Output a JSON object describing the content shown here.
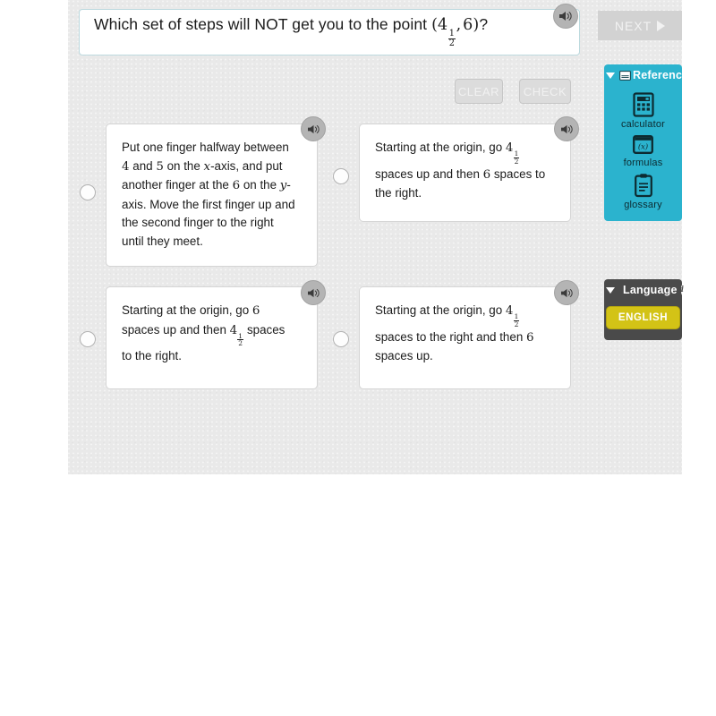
{
  "question": {
    "prefix": "Which set of steps will NOT get you to the point ",
    "point_whole": "4",
    "point_num": "1",
    "point_den": "2",
    "point_y": "6",
    "suffix": "?",
    "speaker_icon": "speaker-icon"
  },
  "toolbar": {
    "clear_label": "CLEAR",
    "check_label": "CHECK",
    "next_label": "NEXT"
  },
  "options": [
    {
      "id": "opt-1",
      "selected": false,
      "parts": [
        {
          "t": "text",
          "v": "Put one finger halfway between "
        },
        {
          "t": "math",
          "v": "4"
        },
        {
          "t": "text",
          "v": " and "
        },
        {
          "t": "math",
          "v": "5"
        },
        {
          "t": "text",
          "v": " on the "
        },
        {
          "t": "mathit",
          "v": "x"
        },
        {
          "t": "text",
          "v": "-axis, and put another finger at the "
        },
        {
          "t": "math",
          "v": "6"
        },
        {
          "t": "text",
          "v": " on the "
        },
        {
          "t": "mathit",
          "v": "y"
        },
        {
          "t": "text",
          "v": "-axis. Move the first finger up and the second finger to the right until they meet."
        }
      ],
      "plain": "Put one finger halfway between 4 and 5 on the x-axis, and put another finger at the 6 on the y-axis. Move the first finger up and the second finger to the right until they meet."
    },
    {
      "id": "opt-2",
      "selected": false,
      "parts": [
        {
          "t": "text",
          "v": "Starting at the origin, go "
        },
        {
          "t": "mixed",
          "whole": "4",
          "num": "1",
          "den": "2"
        },
        {
          "t": "text",
          "v": " spaces up and then "
        },
        {
          "t": "math",
          "v": "6"
        },
        {
          "t": "text",
          "v": " spaces to the right."
        }
      ],
      "plain": "Starting at the origin, go 4 1/2 spaces up and then 6 spaces to the right."
    },
    {
      "id": "opt-3",
      "selected": false,
      "parts": [
        {
          "t": "text",
          "v": "Starting at the origin, go "
        },
        {
          "t": "math",
          "v": "6"
        },
        {
          "t": "text",
          "v": " spaces up and then "
        },
        {
          "t": "mixed",
          "whole": "4",
          "num": "1",
          "den": "2"
        },
        {
          "t": "text",
          "v": " spaces to the right."
        }
      ],
      "plain": "Starting at the origin, go 6 spaces up and then 4 1/2 spaces to the right."
    },
    {
      "id": "opt-4",
      "selected": false,
      "parts": [
        {
          "t": "text",
          "v": "Starting at the origin, go "
        },
        {
          "t": "mixed",
          "whole": "4",
          "num": "1",
          "den": "2"
        },
        {
          "t": "text",
          "v": " spaces to the right and then "
        },
        {
          "t": "math",
          "v": "6"
        },
        {
          "t": "text",
          "v": " spaces up."
        }
      ],
      "plain": "Starting at the origin, go 4 1/2 spaces to the right and then 6 spaces up."
    }
  ],
  "rail": {
    "reference": {
      "title": "Reference",
      "color": "#2bb3ce",
      "items": [
        {
          "label": "calculator",
          "icon": "calculator-icon"
        },
        {
          "label": "formulas",
          "icon": "formulas-icon"
        },
        {
          "label": "glossary",
          "icon": "glossary-icon"
        }
      ]
    },
    "language": {
      "title": "Language",
      "color": "#4a4a4a",
      "info_glyph": "i",
      "button_label": "ENGLISH",
      "button_color": "#d3c316"
    }
  }
}
